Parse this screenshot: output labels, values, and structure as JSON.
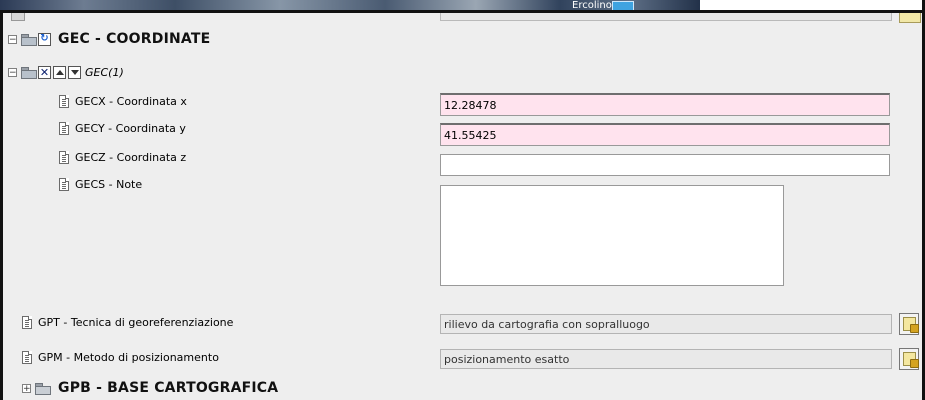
{
  "banner": {
    "label": "Ercolino"
  },
  "sections": {
    "gec": {
      "code": "GEC - COORDINATE",
      "group_label": "GEC(1)",
      "fields": [
        {
          "label": "GECX - Coordinata x",
          "value": "12.28478"
        },
        {
          "label": "GECY - Coordinata y",
          "value": "41.55425"
        },
        {
          "label": "GECZ - Coordinata z",
          "value": ""
        },
        {
          "label": "GECS - Note",
          "value": ""
        }
      ]
    },
    "gpt": {
      "label": "GPT - Tecnica di georeferenziazione",
      "value": "rilievo da cartografia con sopralluogo"
    },
    "gpm": {
      "label": "GPM - Metodo di posizionamento",
      "value": "posizionamento esatto"
    },
    "gpb": {
      "code": "GPB - BASE CARTOGRAFICA"
    }
  },
  "icons": {
    "collapse": "minus-box-icon",
    "expand": "plus-box-icon",
    "folder": "folder-icon",
    "reload": "reload-icon",
    "delete": "close-icon",
    "move_up": "arrow-up-icon",
    "move_down": "arrow-down-icon",
    "field": "document-icon",
    "lookup": "lookup-icon"
  },
  "colors": {
    "required_field_bg": "#ffe3ee",
    "readonly_field_bg": "#e9e9e9",
    "panel_bg": "#eeeeee"
  }
}
